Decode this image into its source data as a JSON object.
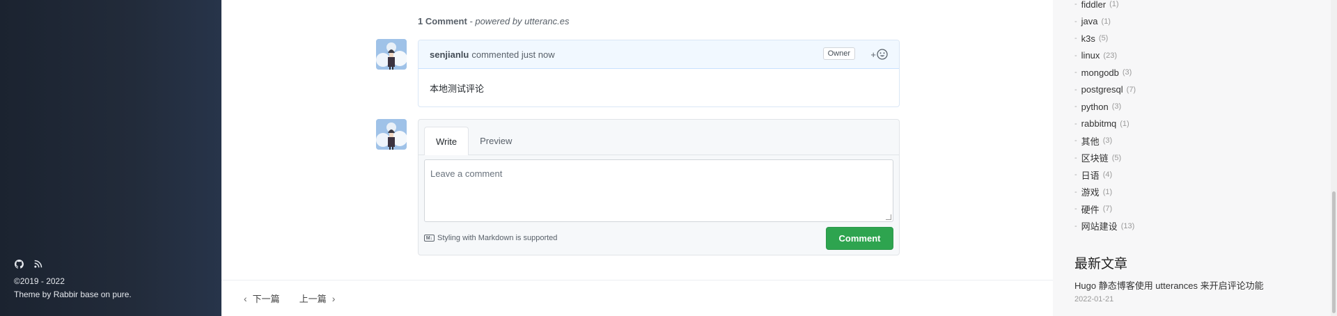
{
  "footer": {
    "icons": [
      "github-icon",
      "rss-icon"
    ],
    "copyright": "©2019 - 2022",
    "theme": "Theme by Rabbir base on pure."
  },
  "comments": {
    "count_label": "1 Comment",
    "powered_by": " - powered by utteranc.es",
    "items": [
      {
        "author": "senjianlu",
        "meta": "commented just now",
        "badge": "Owner",
        "reaction_label": "+",
        "body": "本地测试评论"
      }
    ],
    "new_comment": {
      "tab_write": "Write",
      "tab_preview": "Preview",
      "placeholder": "Leave a comment",
      "markdown_note": "Styling with Markdown is supported",
      "markdown_icon_label": "M↓",
      "submit_label": "Comment"
    }
  },
  "pager": {
    "next_label": "下一篇",
    "prev_label": "上一篇"
  },
  "sidebar": {
    "tags": [
      {
        "name": "fiddler",
        "count": "(1)"
      },
      {
        "name": "java",
        "count": "(1)"
      },
      {
        "name": "k3s",
        "count": "(5)"
      },
      {
        "name": "linux",
        "count": "(23)"
      },
      {
        "name": "mongodb",
        "count": "(3)"
      },
      {
        "name": "postgresql",
        "count": "(7)"
      },
      {
        "name": "python",
        "count": "(3)"
      },
      {
        "name": "rabbitmq",
        "count": "(1)"
      },
      {
        "name": "其他",
        "count": "(3)"
      },
      {
        "name": "区块链",
        "count": "(5)"
      },
      {
        "name": "日语",
        "count": "(4)"
      },
      {
        "name": "游戏",
        "count": "(1)"
      },
      {
        "name": "硬件",
        "count": "(7)"
      },
      {
        "name": "网站建设",
        "count": "(13)"
      }
    ],
    "recent_title": "最新文章",
    "recent_post": "Hugo 静态博客使用 utterances 来开启评论功能",
    "recent_date": "2022-01-21"
  },
  "colors": {
    "sidebar_dark": "#222b3a",
    "comment_button": "#2ea44f",
    "header_bg": "#f1f8ff"
  }
}
